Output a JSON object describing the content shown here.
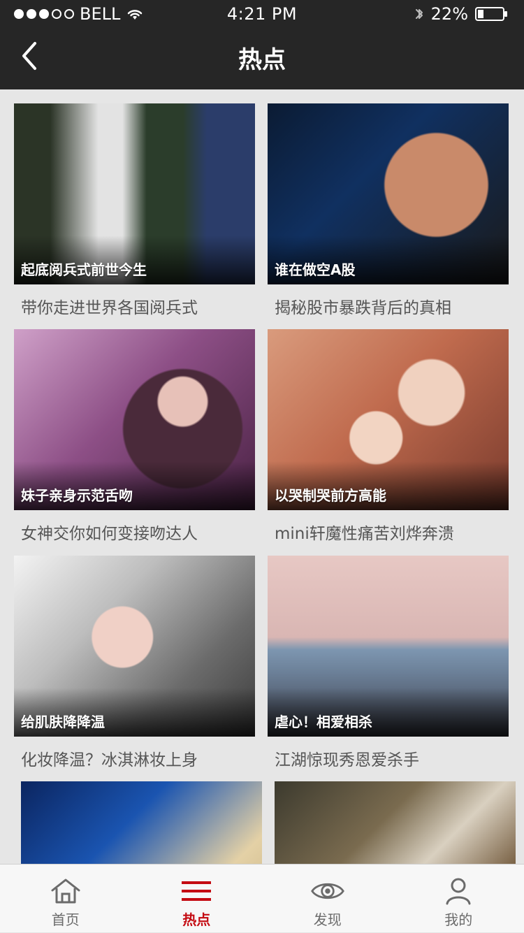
{
  "status_bar": {
    "carrier": "BELL",
    "time": "4:21 PM",
    "battery": "22%",
    "signal_bars_filled": 3,
    "signal_bars_total": 5
  },
  "nav": {
    "title": "热点",
    "back_icon": "chevron-left-icon"
  },
  "cards": [
    {
      "caption": "起底阅兵式前世今生",
      "title": "带你走进世界各国阅兵式"
    },
    {
      "caption": "谁在做空A股",
      "title": "揭秘股市暴跌背后的真相"
    },
    {
      "caption": "妹子亲身示范舌吻",
      "title": "女神交你如何变接吻达人"
    },
    {
      "caption": "以哭制哭前方高能",
      "title": "mini轩魔性痛苦刘烨奔溃"
    },
    {
      "caption": "给肌肤降降温",
      "title": "化妆降温？冰淇淋妆上身"
    },
    {
      "caption": "虐心！相爱相杀",
      "title": "江湖惊现秀恩爱杀手"
    },
    {
      "caption": "",
      "title": ""
    },
    {
      "caption": "",
      "title": ""
    }
  ],
  "tabbar": {
    "active_color": "#c40b12",
    "items": [
      {
        "label": "首页",
        "icon": "home-icon"
      },
      {
        "label": "热点",
        "icon": "menu-icon"
      },
      {
        "label": "发现",
        "icon": "eye-icon"
      },
      {
        "label": "我的",
        "icon": "user-icon"
      }
    ]
  }
}
